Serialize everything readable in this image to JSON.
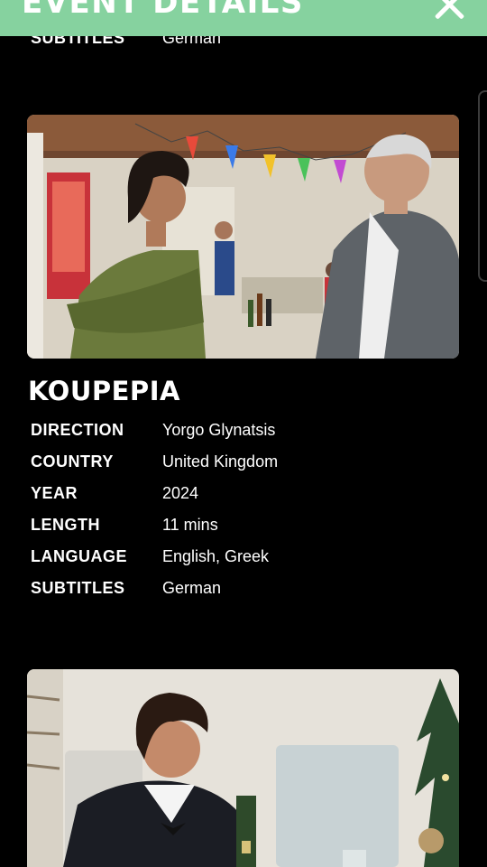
{
  "header": {
    "title": "EVENT DETAILS",
    "close_icon": "close-icon",
    "background_color": "#86d29f"
  },
  "previous_film": {
    "last_row": {
      "key": "SUBTITLES",
      "value": "German"
    }
  },
  "film": {
    "title": "KOUPEPIA",
    "details": [
      {
        "key": "DIRECTION",
        "value": "Yorgo Glynatsis"
      },
      {
        "key": "COUNTRY",
        "value": "United Kingdom"
      },
      {
        "key": "YEAR",
        "value": "2024"
      },
      {
        "key": "LENGTH",
        "value": "11 mins"
      },
      {
        "key": "LANGUAGE",
        "value": "English, Greek"
      },
      {
        "key": "SUBTITLES",
        "value": "German"
      }
    ]
  }
}
